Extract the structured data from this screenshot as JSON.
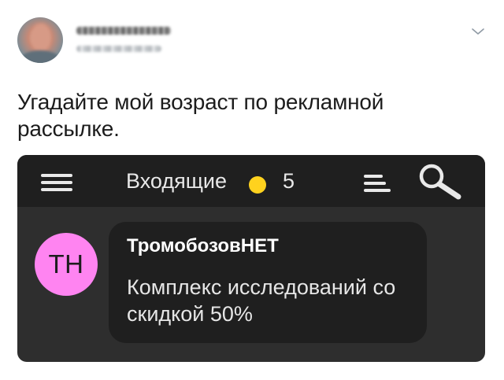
{
  "tweet": {
    "text": "Угадайте мой возраст по рекламной рассылке."
  },
  "mail_app": {
    "folder_title": "Входящие",
    "unread_count": "5",
    "unread_dot_color": "#ffd21e",
    "icons": {
      "menu": "hamburger-icon",
      "sort": "sort-icon",
      "search": "search-icon"
    },
    "message": {
      "avatar_initials": "ТН",
      "avatar_color": "#ff84f1",
      "sender": "ТромобозовНЕТ",
      "preview": "Комплекс исследований со скидкой 50%"
    }
  }
}
